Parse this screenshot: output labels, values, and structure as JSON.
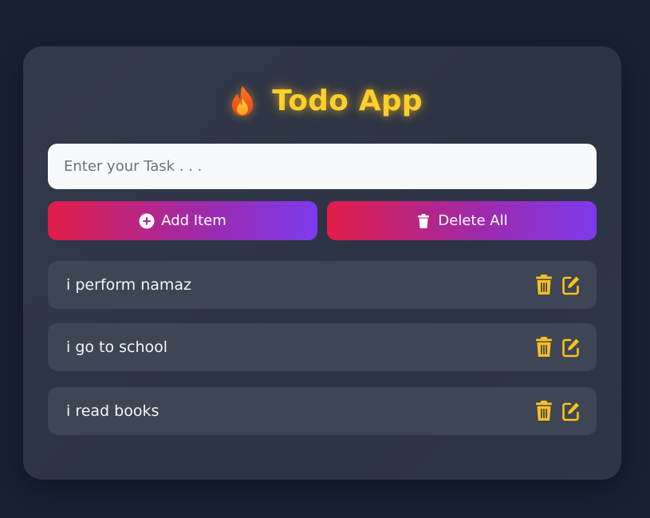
{
  "app": {
    "title": "Todo App",
    "title_icon": "flame-icon"
  },
  "input": {
    "placeholder": "Enter your Task . . .",
    "value": ""
  },
  "buttons": {
    "add_label": "Add Item",
    "add_icon": "plus-circle-icon",
    "delete_all_label": "Delete All",
    "delete_all_icon": "trash-icon"
  },
  "todos": [
    {
      "text": "i perform namaz"
    },
    {
      "text": "i go to school"
    },
    {
      "text": "i read books"
    }
  ],
  "colors": {
    "background": "#182033",
    "card": "#2f3646",
    "accent_yellow": "#ffcf2a",
    "gradient_start": "#e11d48",
    "gradient_end": "#7c3aed",
    "item_bg": "#3e4554"
  }
}
